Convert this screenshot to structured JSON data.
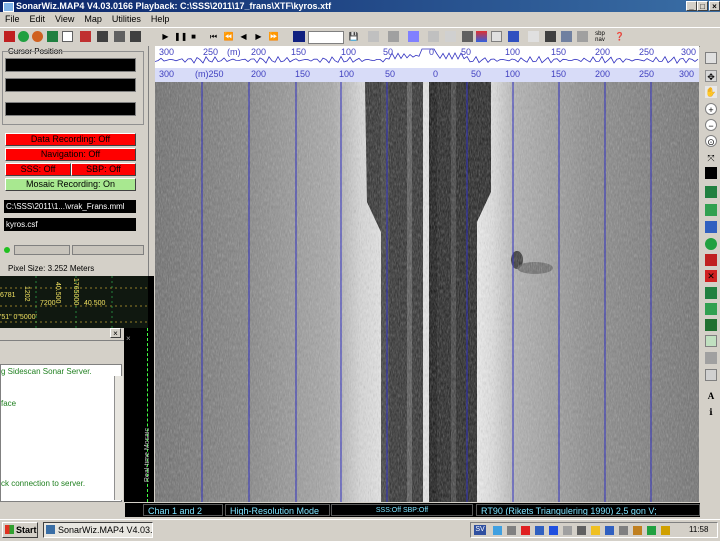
{
  "window": {
    "title": "SonarWiz.MAP4 V4.03.0166 Playback: C:\\SSS\\2011\\17_frans\\XTF\\kyros.xtf"
  },
  "menu": [
    "File",
    "Edit",
    "View",
    "Map",
    "Utilities",
    "Help"
  ],
  "toolbar": {
    "sbp_nav_label": "sbp\nnav"
  },
  "left_panel": {
    "cursor_position_label": "Cursor Position",
    "data_recording": "Data Recording: Off",
    "navigation": "Navigation: Off",
    "sss": "SSS: Off",
    "sbp": "SBP: Off",
    "mosaic_recording": "Mosaic Recording: On",
    "mosaic_path": "C:\\SSS\\2011\\1...\\vrak_Frans.mml",
    "csf_file": "kyros.csf",
    "pixel_size": "Pixel Size: 3.252 Meters",
    "coords": [
      "6781",
      "1202",
      "1765000",
      "7200",
      "40.500",
      "'51\" 0\"5000'",
      "40.500"
    ],
    "log_lines": [
      "g Sidescan Sonar Server.",
      "face",
      "ck connection to server."
    ],
    "vertical_label": "Real-time Mosaic"
  },
  "scale": {
    "top_labels": [
      "300",
      "250",
      "(m)",
      "200",
      "150",
      "100",
      "50",
      "0",
      "50",
      "100",
      "150",
      "200",
      "250",
      "300"
    ],
    "lower_labels": [
      "300",
      "(m)250",
      "200",
      "150",
      "100",
      "50",
      "0",
      "50",
      "100",
      "150",
      "200",
      "250",
      "300"
    ]
  },
  "status": {
    "channel": "Chan 1 and 2",
    "mode": "High-Resolution Mode",
    "sss_sbp": "SSS:Off    SBP:Off",
    "projection": "RT90 (Rikets Triangulering 1990) 2,5 gon V;"
  },
  "taskbar": {
    "start": "Start",
    "task": "SonarWiz.MAP4 V4.03...",
    "lang": "SV",
    "clock": "11:58"
  },
  "colors": {
    "accent_red": "#ff0000",
    "accent_green": "#a8e890",
    "scale_blue": "#3030c0",
    "status_text": "#7ee3ff"
  }
}
